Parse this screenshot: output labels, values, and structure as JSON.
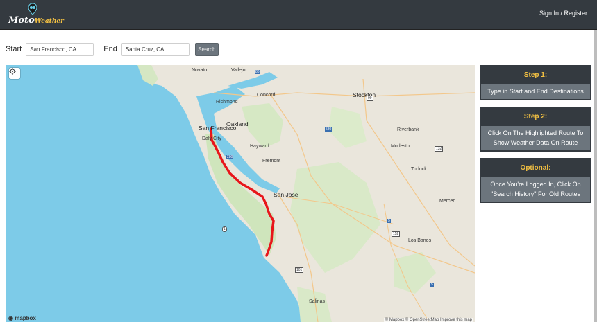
{
  "navbar": {
    "logo_main": "Moto",
    "logo_sub": "Weather",
    "signin_label": "Sign In / Register"
  },
  "form": {
    "start_label": "Start",
    "start_value": "San Francisco, CA",
    "end_label": "End",
    "end_value": "Santa Cruz, CA",
    "search_label": "Search"
  },
  "map": {
    "cities": {
      "novato": "Novato",
      "vallejo": "Vallejo",
      "concord": "Concord",
      "stockton": "Stockton",
      "richmond": "Richmond",
      "oakland": "Oakland",
      "san_francisco": "San Francisco",
      "daly_city": "Daly City",
      "hayward": "Hayward",
      "riverbank": "Riverbank",
      "modesto": "Modesto",
      "fremont": "Fremont",
      "turlock": "Turlock",
      "san_jose": "San Jose",
      "merced": "Merced",
      "los_banos": "Los Banos",
      "salinas": "Salinas"
    },
    "shields": {
      "i80": "80",
      "i580": "580",
      "i280": "280",
      "i5": "5",
      "us99": "99",
      "us101": "101",
      "sr1": "1",
      "sr132": "132",
      "sr152": "152",
      "i5b": "5"
    },
    "mapbox_logo": "mapbox",
    "attribution": "© Mapbox © OpenStreetMap Improve this map",
    "route_color": "#e8161b"
  },
  "steps": [
    {
      "title": "Step 1:",
      "text": "Type in Start and End Destinations"
    },
    {
      "title": "Step 2:",
      "text": "Click On The Highlighted Route To Show Weather Data On Route"
    },
    {
      "title": "Optional:",
      "text": "Once You're Logged In, Click On \"Search History\" For Old Routes"
    }
  ]
}
